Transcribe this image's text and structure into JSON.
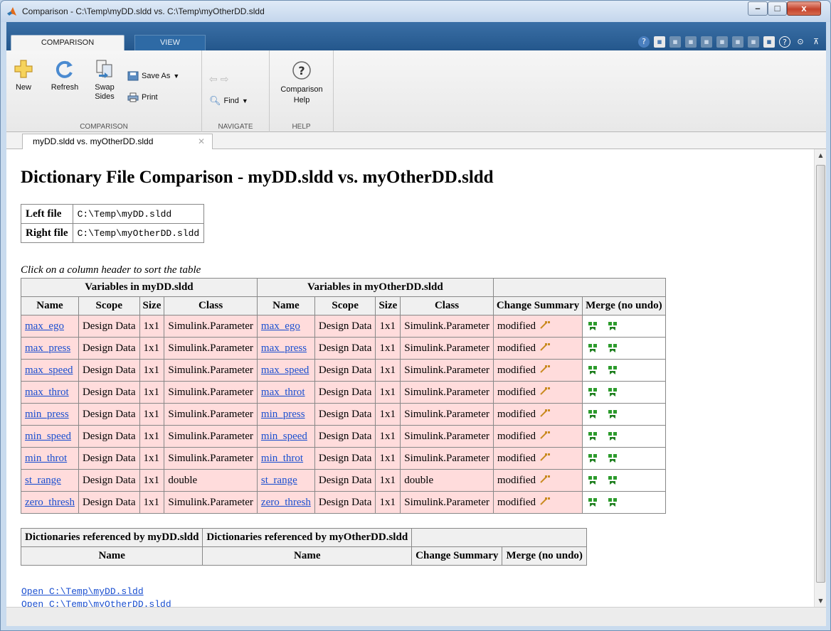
{
  "window": {
    "title": "Comparison - C:\\Temp\\myDD.sldd vs. C:\\Temp\\myOtherDD.sldd",
    "controls": {
      "minimize": "–",
      "maximize": "□",
      "close": "x"
    }
  },
  "ribbon_tabs": {
    "comparison": "COMPARISON",
    "view": "VIEW"
  },
  "quick_access": [
    "?",
    "▪",
    "▪",
    "▪",
    "▪",
    "▪",
    "▪",
    "▪",
    "▪",
    "?",
    "⊙",
    "⊼"
  ],
  "ribbon": {
    "comparison_group": {
      "label": "COMPARISON",
      "new": "New",
      "refresh": "Refresh",
      "swap_sides": "Swap Sides",
      "save_as": "Save As",
      "print": "Print"
    },
    "navigate_group": {
      "label": "NAVIGATE",
      "find": "Find"
    },
    "help_group": {
      "label": "HELP",
      "comparison_help": "Comparison Help"
    }
  },
  "doc_tab": {
    "label": "myDD.sldd vs. myOtherDD.sldd",
    "close": "✕"
  },
  "report": {
    "heading": "Dictionary File Comparison - myDD.sldd vs. myOtherDD.sldd",
    "left_file_label": "Left file",
    "left_file_value": "C:\\Temp\\myDD.sldd",
    "right_file_label": "Right file",
    "right_file_value": "C:\\Temp\\myOtherDD.sldd",
    "sort_note": "Click on a column header to sort the table",
    "variables_table": {
      "left_group": "Variables in myDD.sldd",
      "right_group": "Variables in myOtherDD.sldd",
      "columns": [
        "Name",
        "Scope",
        "Size",
        "Class",
        "Name",
        "Scope",
        "Size",
        "Class",
        "Change Summary",
        "Merge (no undo)"
      ],
      "rows": [
        {
          "name": "max_ego",
          "scope": "Design Data",
          "size": "1x1",
          "class": "Simulink.Parameter",
          "change": "modified"
        },
        {
          "name": "max_press",
          "scope": "Design Data",
          "size": "1x1",
          "class": "Simulink.Parameter",
          "change": "modified"
        },
        {
          "name": "max_speed",
          "scope": "Design Data",
          "size": "1x1",
          "class": "Simulink.Parameter",
          "change": "modified"
        },
        {
          "name": "max_throt",
          "scope": "Design Data",
          "size": "1x1",
          "class": "Simulink.Parameter",
          "change": "modified"
        },
        {
          "name": "min_press",
          "scope": "Design Data",
          "size": "1x1",
          "class": "Simulink.Parameter",
          "change": "modified"
        },
        {
          "name": "min_speed",
          "scope": "Design Data",
          "size": "1x1",
          "class": "Simulink.Parameter",
          "change": "modified"
        },
        {
          "name": "min_throt",
          "scope": "Design Data",
          "size": "1x1",
          "class": "Simulink.Parameter",
          "change": "modified"
        },
        {
          "name": "st_range",
          "scope": "Design Data",
          "size": "1x1",
          "class": "double",
          "change": "modified"
        },
        {
          "name": "zero_thresh",
          "scope": "Design Data",
          "size": "1x1",
          "class": "Simulink.Parameter",
          "change": "modified"
        }
      ]
    },
    "refs_table": {
      "left_group": "Dictionaries referenced by myDD.sldd",
      "right_group": "Dictionaries referenced by myOtherDD.sldd",
      "columns": [
        "Name",
        "Name",
        "Change Summary",
        "Merge (no undo)"
      ]
    },
    "links": [
      "Open C:\\Temp\\myDD.sldd",
      "Open C:\\Temp\\myOtherDD.sldd"
    ]
  },
  "colors": {
    "modified_row": "#ffdcdc",
    "link": "#1a4fd0",
    "ribbon_tab_bar": "#24578c"
  }
}
